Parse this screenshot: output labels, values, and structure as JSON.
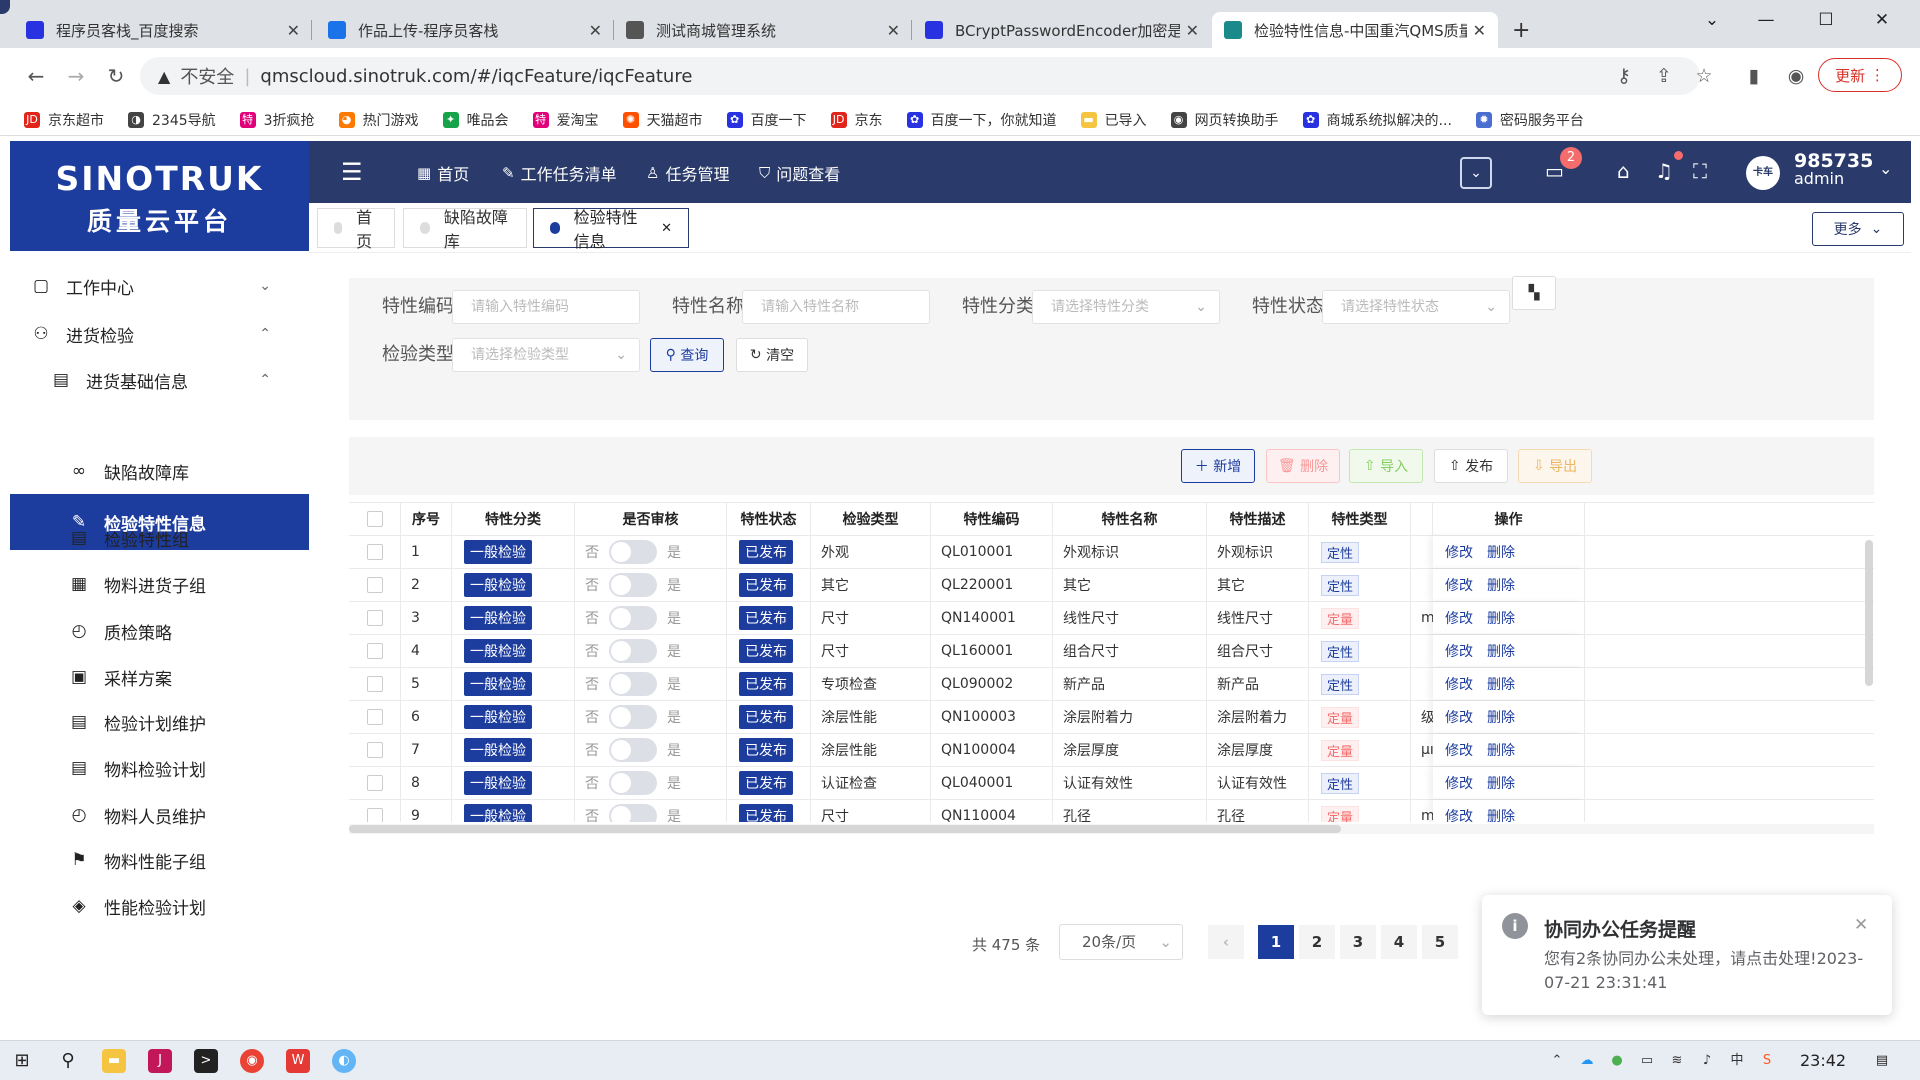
{
  "browser": {
    "tabs": [
      {
        "title": "程序员客栈_百度搜索",
        "color": "#2932e1"
      },
      {
        "title": "作品上传-程序员客栈",
        "color": "#1a73e8"
      },
      {
        "title": "测试商城管理系统",
        "color": "#555555"
      },
      {
        "title": "BCryptPasswordEncoder加密是",
        "color": "#2932e1"
      },
      {
        "title": "检验特性信息-中国重汽QMS质量",
        "color": "#1a8a8a"
      }
    ],
    "new_tab": "+",
    "url_insecure": "不安全",
    "url": "qmscloud.sinotruk.com/#/iqcFeature/iqcFeature",
    "update_label": "更新",
    "bookmarks": [
      {
        "label": "京东超市",
        "color": "#e1251b",
        "glyph": "JD"
      },
      {
        "label": "2345导航",
        "color": "#444444",
        "glyph": "◑"
      },
      {
        "label": "3折疯抢",
        "color": "#e0007a",
        "glyph": "特"
      },
      {
        "label": "热门游戏",
        "color": "#ff7a00",
        "glyph": "◕"
      },
      {
        "label": "唯品会",
        "color": "#16a34a",
        "glyph": "✦"
      },
      {
        "label": "爱淘宝",
        "color": "#e0007a",
        "glyph": "特"
      },
      {
        "label": "天猫超市",
        "color": "#ff5000",
        "glyph": "✺"
      },
      {
        "label": "百度一下",
        "color": "#2932e1",
        "glyph": "✿"
      },
      {
        "label": "京东",
        "color": "#e1251b",
        "glyph": "JD"
      },
      {
        "label": "百度一下，你就知道",
        "color": "#2932e1",
        "glyph": "✿"
      },
      {
        "label": "已导入",
        "color": "#f5c542",
        "glyph": "▬"
      },
      {
        "label": "网页转换助手",
        "color": "#444444",
        "glyph": "◉"
      },
      {
        "label": "商城系统拟解决的...",
        "color": "#2932e1",
        "glyph": "✿"
      },
      {
        "label": "密码服务平台",
        "color": "#4a6fd1",
        "glyph": "✹"
      }
    ]
  },
  "app": {
    "logo_line1": "SINOTRUK",
    "logo_line2": "质量云平台",
    "topnav": [
      "首页",
      "工作任务清单",
      "任务管理",
      "问题查看"
    ],
    "notif_count": "2",
    "user_id": "985735",
    "user_role": "admin",
    "avatar_text": "卡车",
    "page_tabs": [
      "首页",
      "缺陷故障库",
      "检验特性信息"
    ],
    "more_label": "更多"
  },
  "sidebar": [
    {
      "label": "工作中心",
      "icon": "▢",
      "chev": "⌄"
    },
    {
      "label": "进货检验",
      "icon": "⚇",
      "chev": "⌃"
    },
    {
      "label": "进货基础信息",
      "icon": "▤",
      "chev": "⌃"
    },
    {
      "label": "缺陷故障库",
      "icon": "∞"
    },
    {
      "label": "检验特性信息",
      "icon": "✎"
    },
    {
      "label": "检验特性组",
      "icon": "▤"
    },
    {
      "label": "物料进货子组",
      "icon": "▦"
    },
    {
      "label": "质检策略",
      "icon": "◴"
    },
    {
      "label": "采样方案",
      "icon": "▣"
    },
    {
      "label": "检验计划维护",
      "icon": "▤"
    },
    {
      "label": "物料检验计划",
      "icon": "▤"
    },
    {
      "label": "物料人员维护",
      "icon": "◴"
    },
    {
      "label": "物料性能子组",
      "icon": "⚑"
    },
    {
      "label": "性能检验计划",
      "icon": "◈"
    }
  ],
  "filters": {
    "code_label": "特性编码",
    "code_ph": "请输入特性编码",
    "name_label": "特性名称",
    "name_ph": "请输入特性名称",
    "class_label": "特性分类",
    "class_ph": "请选择特性分类",
    "status_label": "特性状态",
    "status_ph": "请选择特性状态",
    "type_label": "检验类型",
    "type_ph": "请选择检验类型",
    "query": "查询",
    "clear": "清空"
  },
  "toolbar": {
    "add": "新增",
    "delete": "删除",
    "import": "导入",
    "publish": "发布",
    "export": "导出"
  },
  "table": {
    "headers": [
      "序号",
      "特性分类",
      "是否审核",
      "特性状态",
      "检验类型",
      "特性编码",
      "特性名称",
      "特性描述",
      "特性类型",
      "操作"
    ],
    "no": "否",
    "yes": "是",
    "edit": "修改",
    "del": "删除",
    "rows": [
      {
        "idx": "1",
        "cls": "一般检验",
        "status": "已发布",
        "itype": "外观",
        "code": "QL010001",
        "name": "外观标识",
        "desc": "外观标识",
        "ftype": "定性",
        "extra": ""
      },
      {
        "idx": "2",
        "cls": "一般检验",
        "status": "已发布",
        "itype": "其它",
        "code": "QL220001",
        "name": "其它",
        "desc": "其它",
        "ftype": "定性",
        "extra": ""
      },
      {
        "idx": "3",
        "cls": "一般检验",
        "status": "已发布",
        "itype": "尺寸",
        "code": "QN140001",
        "name": "线性尺寸",
        "desc": "线性尺寸",
        "ftype": "定量",
        "extra": "mi"
      },
      {
        "idx": "4",
        "cls": "一般检验",
        "status": "已发布",
        "itype": "尺寸",
        "code": "QL160001",
        "name": "组合尺寸",
        "desc": "组合尺寸",
        "ftype": "定性",
        "extra": ""
      },
      {
        "idx": "5",
        "cls": "一般检验",
        "status": "已发布",
        "itype": "专项检查",
        "code": "QL090002",
        "name": "新产品",
        "desc": "新产品",
        "ftype": "定性",
        "extra": ""
      },
      {
        "idx": "6",
        "cls": "一般检验",
        "status": "已发布",
        "itype": "涂层性能",
        "code": "QN100003",
        "name": "涂层附着力",
        "desc": "涂层附着力",
        "ftype": "定量",
        "extra": "级"
      },
      {
        "idx": "7",
        "cls": "一般检验",
        "status": "已发布",
        "itype": "涂层性能",
        "code": "QN100004",
        "name": "涂层厚度",
        "desc": "涂层厚度",
        "ftype": "定量",
        "extra": "μı"
      },
      {
        "idx": "8",
        "cls": "一般检验",
        "status": "已发布",
        "itype": "认证检查",
        "code": "QL040001",
        "name": "认证有效性",
        "desc": "认证有效性",
        "ftype": "定性",
        "extra": ""
      },
      {
        "idx": "9",
        "cls": "一般检验",
        "status": "已发布",
        "itype": "尺寸",
        "code": "QN110004",
        "name": "孔径",
        "desc": "孔径",
        "ftype": "定量",
        "extra": "mi"
      }
    ]
  },
  "pager": {
    "total": "共 475 条",
    "size": "20条/页",
    "pages": [
      "1",
      "2",
      "3",
      "4",
      "5"
    ],
    "prev": "‹"
  },
  "notification": {
    "title": "协同办公任务提醒",
    "body": "您有2条协同办公未处理，请点击处理!",
    "time": "2023-07-21 23:31:41"
  },
  "taskbar": {
    "time": "23:42"
  }
}
